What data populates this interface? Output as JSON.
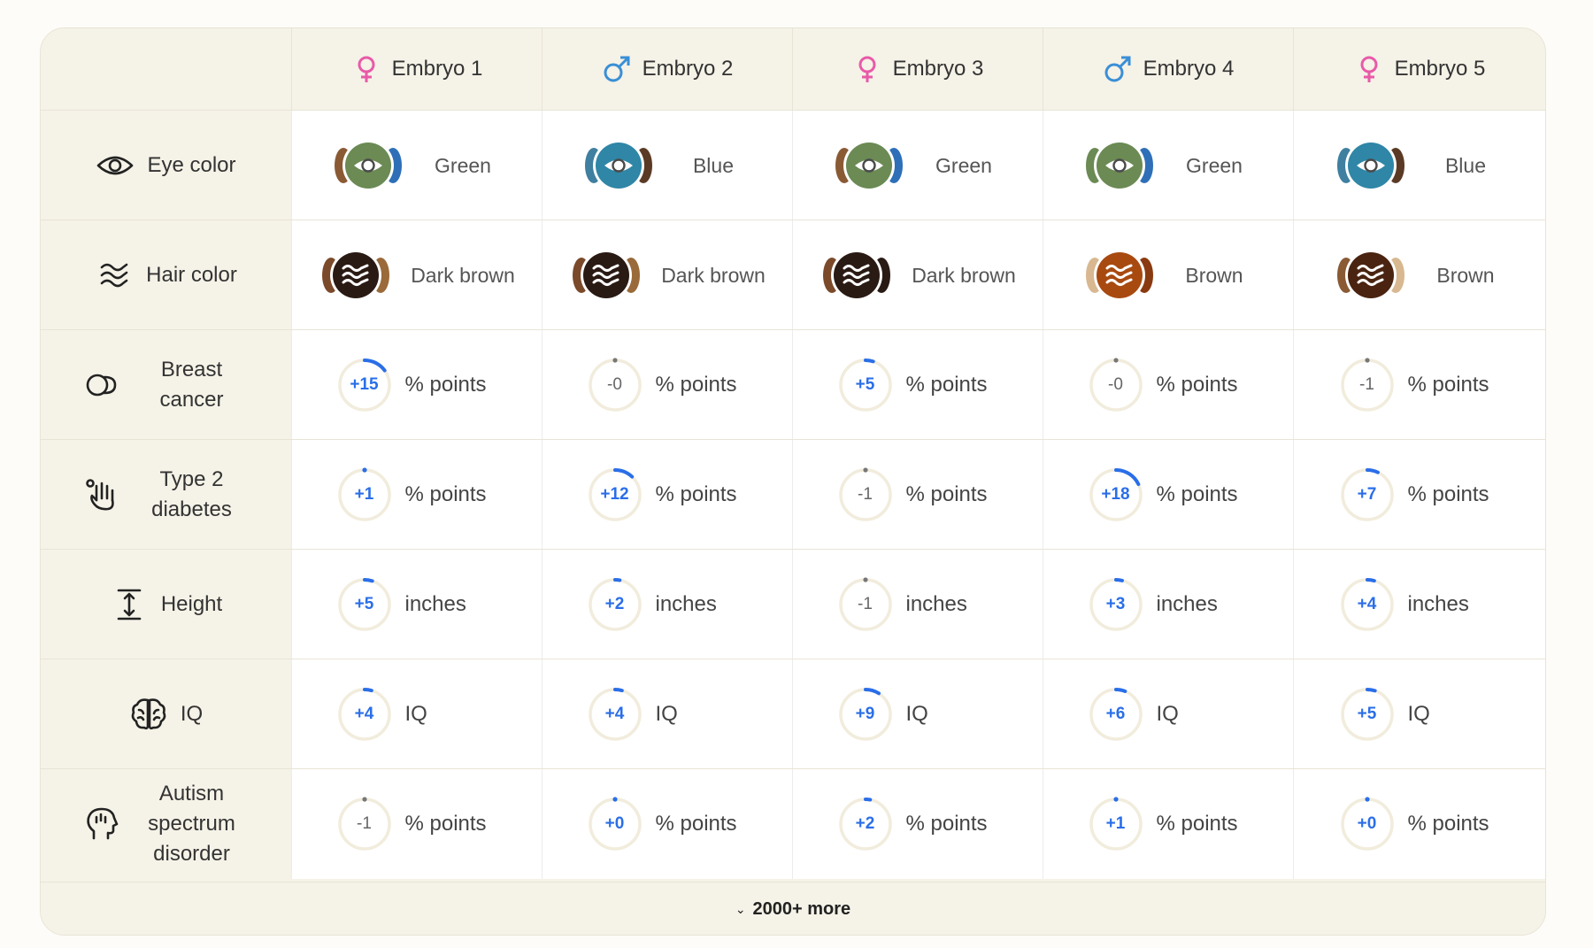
{
  "embryos": [
    {
      "label": "Embryo 1",
      "sex": "female"
    },
    {
      "label": "Embryo 2",
      "sex": "male"
    },
    {
      "label": "Embryo 3",
      "sex": "female"
    },
    {
      "label": "Embryo 4",
      "sex": "male"
    },
    {
      "label": "Embryo 5",
      "sex": "female"
    }
  ],
  "colors": {
    "female": "#e85aa8",
    "male": "#3a8fd6",
    "accent": "#2a6ee8",
    "ring_track": "#f1ecdc",
    "neutral_dot": "#777777"
  },
  "traits": [
    {
      "name": "Eye color",
      "icon": "eye-icon",
      "kind": "color",
      "cells": [
        {
          "label": "Green",
          "fill": "#6b8a54",
          "left": "#8a5a35",
          "right": "#2e6fb8"
        },
        {
          "label": "Blue",
          "fill": "#2f86a6",
          "left": "#3f7fa0",
          "right": "#5a3a25"
        },
        {
          "label": "Green",
          "fill": "#6b8a54",
          "left": "#8a5a35",
          "right": "#2e6fb8"
        },
        {
          "label": "Green",
          "fill": "#6b8a54",
          "left": "#6b8a54",
          "right": "#2e6fb8"
        },
        {
          "label": "Blue",
          "fill": "#2f86a6",
          "left": "#3f7fa0",
          "right": "#5a3a25"
        }
      ]
    },
    {
      "name": "Hair color",
      "icon": "waves-icon",
      "kind": "color",
      "cells": [
        {
          "label": "Dark brown",
          "fill": "#2a1a14",
          "left": "#7a4a2a",
          "right": "#9a6a3a"
        },
        {
          "label": "Dark brown",
          "fill": "#2a1a14",
          "left": "#7a4a2a",
          "right": "#9a6a3a"
        },
        {
          "label": "Dark brown",
          "fill": "#2a1a14",
          "left": "#7a4a2a",
          "right": "#2a1a14"
        },
        {
          "label": "Brown",
          "fill": "#a84a10",
          "left": "#d8b890",
          "right": "#8a3a10"
        },
        {
          "label": "Brown",
          "fill": "#4a2410",
          "left": "#8a5a35",
          "right": "#d8b890"
        }
      ]
    },
    {
      "name": "Breast cancer",
      "icon": "breast-icon",
      "kind": "ring",
      "cells": [
        {
          "value": "+15",
          "unit": "% points",
          "frac": 0.15
        },
        {
          "value": "-0",
          "unit": "% points",
          "frac": 0
        },
        {
          "value": "+5",
          "unit": "% points",
          "frac": 0.05
        },
        {
          "value": "-0",
          "unit": "% points",
          "frac": 0
        },
        {
          "value": "-1",
          "unit": "% points",
          "frac": 0
        }
      ]
    },
    {
      "name": "Type 2 diabetes",
      "icon": "hand-icon",
      "kind": "ring",
      "cells": [
        {
          "value": "+1",
          "unit": "% points",
          "frac": 0.01
        },
        {
          "value": "+12",
          "unit": "% points",
          "frac": 0.12
        },
        {
          "value": "-1",
          "unit": "% points",
          "frac": 0
        },
        {
          "value": "+18",
          "unit": "% points",
          "frac": 0.18
        },
        {
          "value": "+7",
          "unit": "% points",
          "frac": 0.07
        }
      ]
    },
    {
      "name": "Height",
      "icon": "height-icon",
      "kind": "ring",
      "cells": [
        {
          "value": "+5",
          "unit": "inches",
          "frac": 0.05
        },
        {
          "value": "+2",
          "unit": "inches",
          "frac": 0.03
        },
        {
          "value": "-1",
          "unit": "inches",
          "frac": 0
        },
        {
          "value": "+3",
          "unit": "inches",
          "frac": 0.04
        },
        {
          "value": "+4",
          "unit": "inches",
          "frac": 0.045
        }
      ]
    },
    {
      "name": "IQ",
      "icon": "brain-icon",
      "kind": "ring",
      "cells": [
        {
          "value": "+4",
          "unit": "IQ",
          "frac": 0.045
        },
        {
          "value": "+4",
          "unit": "IQ",
          "frac": 0.045
        },
        {
          "value": "+9",
          "unit": "IQ",
          "frac": 0.09
        },
        {
          "value": "+6",
          "unit": "IQ",
          "frac": 0.06
        },
        {
          "value": "+5",
          "unit": "IQ",
          "frac": 0.05
        }
      ]
    },
    {
      "name": "Autism spectrum disorder",
      "icon": "head-icon",
      "kind": "ring",
      "cells": [
        {
          "value": "-1",
          "unit": "% points",
          "frac": 0
        },
        {
          "value": "+0",
          "unit": "% points",
          "frac": 0.01
        },
        {
          "value": "+2",
          "unit": "% points",
          "frac": 0.03
        },
        {
          "value": "+1",
          "unit": "% points",
          "frac": 0.015
        },
        {
          "value": "+0",
          "unit": "% points",
          "frac": 0.01
        }
      ]
    }
  ],
  "footer": {
    "label": "2000+ more",
    "icon": "chevron-down-icon"
  }
}
